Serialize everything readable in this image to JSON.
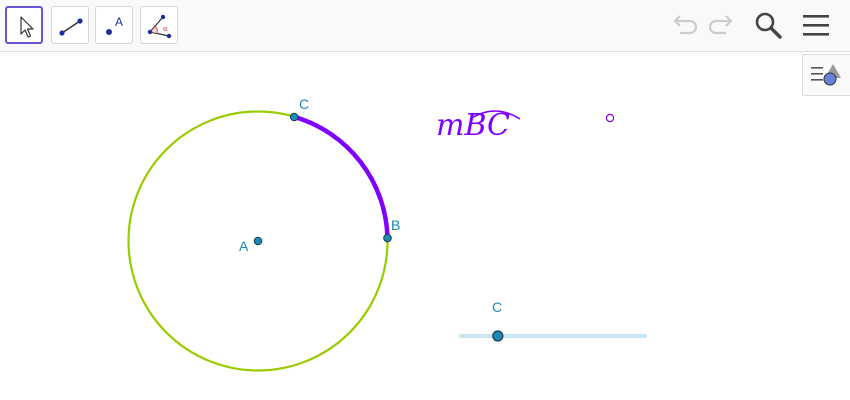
{
  "toolbar": {
    "tools": [
      {
        "name": "move-tool",
        "active": true
      },
      {
        "name": "segment-tool",
        "active": false
      },
      {
        "name": "point-tool",
        "active": false,
        "glyph": "A"
      },
      {
        "name": "angle-tool",
        "active": false,
        "glyph": "α"
      }
    ],
    "right": {
      "undo_icon": "undo-icon",
      "redo_icon": "redo-icon",
      "search_icon": "search-icon",
      "menu_icon": "menu-icon"
    },
    "style_bar_icon": "style-bar-toggle-icon"
  },
  "canvas": {
    "points": {
      "A": "A",
      "B": "B",
      "C": "C"
    },
    "arc_measure_text": "mBC",
    "arc_measure_prefix": "m",
    "arc_measure_arc_letters": "BC",
    "slider_label": "C",
    "slider_value_fraction": 0.2
  },
  "colors": {
    "circle": "#99cc00",
    "arc": "#8000ff",
    "point_fill": "#1a8cb0",
    "point_label": "#1a8cb0",
    "slider_track": "#c9e7f2",
    "toolbar_active_border": "#6557d2",
    "disabled_icon": "#cccccc",
    "icon_dark": "#444444"
  }
}
